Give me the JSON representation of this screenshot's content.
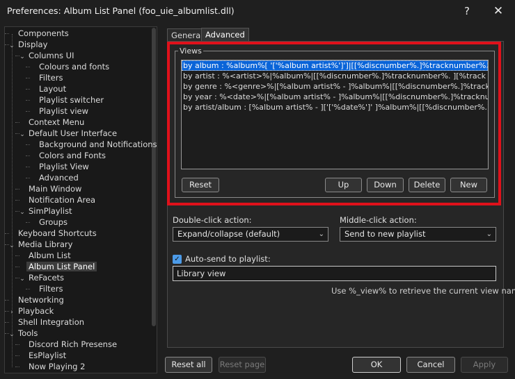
{
  "window": {
    "title": "Preferences: Album List Panel (foo_uie_albumlist.dll)",
    "help": "?",
    "close": "✕"
  },
  "tree": [
    {
      "label": "Components",
      "exp": ""
    },
    {
      "label": "Display",
      "exp": "⌄"
    },
    {
      "label": "Columns UI",
      "exp": "⌄"
    },
    {
      "label": "Colours and fonts",
      "exp": ""
    },
    {
      "label": "Filters",
      "exp": ""
    },
    {
      "label": "Layout",
      "exp": ""
    },
    {
      "label": "Playlist switcher",
      "exp": ""
    },
    {
      "label": "Playlist view",
      "exp": ""
    },
    {
      "label": "Context Menu",
      "exp": ""
    },
    {
      "label": "Default User Interface",
      "exp": "⌄"
    },
    {
      "label": "Background and Notifications",
      "exp": ""
    },
    {
      "label": "Colors and Fonts",
      "exp": ""
    },
    {
      "label": "Playlist View",
      "exp": ""
    },
    {
      "label": "Advanced",
      "exp": ""
    },
    {
      "label": "Main Window",
      "exp": ""
    },
    {
      "label": "Notification Area",
      "exp": ""
    },
    {
      "label": "SimPlaylist",
      "exp": "⌄"
    },
    {
      "label": "Groups",
      "exp": ""
    },
    {
      "label": "Keyboard Shortcuts",
      "exp": ""
    },
    {
      "label": "Media Library",
      "exp": "⌄"
    },
    {
      "label": "Album List",
      "exp": ""
    },
    {
      "label": "Album List Panel",
      "exp": ""
    },
    {
      "label": "ReFacets",
      "exp": "⌄"
    },
    {
      "label": "Filters",
      "exp": ""
    },
    {
      "label": "Networking",
      "exp": ""
    },
    {
      "label": "Playback",
      "exp": "›"
    },
    {
      "label": "Shell Integration",
      "exp": ""
    },
    {
      "label": "Tools",
      "exp": "⌄"
    },
    {
      "label": "Discord Rich Presense",
      "exp": ""
    },
    {
      "label": "EsPlaylist",
      "exp": ""
    },
    {
      "label": "Now Playing 2",
      "exp": ""
    }
  ],
  "tabs": {
    "general": "General",
    "advanced": "Advanced"
  },
  "views": {
    "legend": "Views",
    "items": [
      "by album : %album%[ '['%album artist%']']|[[%discnumber%.]%tracknumber%. ][%track artist% - ]%title%",
      "by artist : %<artist>%|%album%|[[%discnumber%.]%tracknumber%. ][%track artist% - ]%title%",
      "by genre : %<genre>%|[%album artist% - ]%album%|[[%discnumber%.]%tracknumber%. ][%track artist% - ]%title%",
      "by year : %<date>%|[%album artist% - ]%album%|[[%discnumber%.]%tracknumber%. ][%track artist% - ]%title%",
      "by artist/album : [%album artist% - ]['['%date%']' ]%album%|[[%discnumber%.]%tracknumber%. ][%track artist% - ]%title%"
    ],
    "reset": "Reset",
    "up": "Up",
    "down": "Down",
    "delete": "Delete",
    "new": "New"
  },
  "double_click": {
    "label": "Double-click action:",
    "value": "Expand/collapse (default)"
  },
  "middle_click": {
    "label": "Middle-click action:",
    "value": "Send to new playlist"
  },
  "autosend": {
    "label": "Auto-send to playlist:",
    "value": "Library view",
    "hint": "Use %_view% to retrieve the current view name"
  },
  "footer": {
    "reset_all": "Reset all",
    "reset_page": "Reset page",
    "ok": "OK",
    "cancel": "Cancel",
    "apply": "Apply"
  }
}
